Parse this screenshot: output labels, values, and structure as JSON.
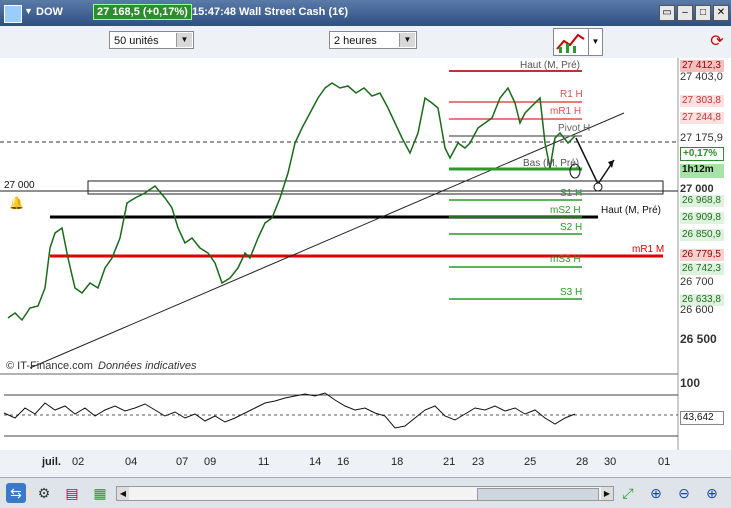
{
  "title_bar": {
    "symbol": "DOW",
    "price_badge": "27 168,5 (+0,17%)",
    "time": "15:47:48",
    "instrument": "Wall Street Cash (1€)",
    "colors": {
      "badge": "#2e8b2e",
      "bar": "#3b5f94"
    }
  },
  "toolbar": {
    "units_select": "50 unités",
    "period_select": "2 heures"
  },
  "chart": {
    "copyright": "© IT-Finance.com",
    "subtitle": "Données indicatives",
    "left_level_label": "27 000",
    "haut_label": "Haut (M, Pré)",
    "levels": [
      {
        "label": "Haut (M, Pré)",
        "color": "#c44"
      },
      {
        "label": "R1 H",
        "color": "#e05050"
      },
      {
        "label": "mR1 H",
        "color": "#e05050"
      },
      {
        "label": "Pivot H",
        "color": "#666"
      },
      {
        "label": "Bas (M, Pré)",
        "color": "#2a9a2a"
      },
      {
        "label": "S1 H",
        "color": "#2a9a2a"
      },
      {
        "label": "mS2 H",
        "color": "#2a9a2a"
      },
      {
        "label": "S2 H",
        "color": "#2a9a2a"
      },
      {
        "label": "mS3 H",
        "color": "#2a9a2a"
      },
      {
        "label": "S3 H",
        "color": "#2a9a2a"
      },
      {
        "label": "mR1 M",
        "color": "#e00000"
      }
    ],
    "price_axis": [
      "27 412,3",
      "27 403,0",
      "27 303,8",
      "27 244,8",
      "27 175,9",
      "+0,17%",
      "1h12m",
      "27 000",
      "26 968,8",
      "26 909,8",
      "26 850,9",
      "26 779,5",
      "26 742,3",
      "26 700",
      "26 633,8",
      "26 600",
      "26 500"
    ],
    "oscillator_axis": [
      "100",
      "43,642"
    ],
    "x_axis": [
      "juil.",
      "02",
      "04",
      "07",
      "09",
      "11",
      "14",
      "16",
      "18",
      "21",
      "23",
      "25",
      "28",
      "30",
      "01"
    ]
  }
}
